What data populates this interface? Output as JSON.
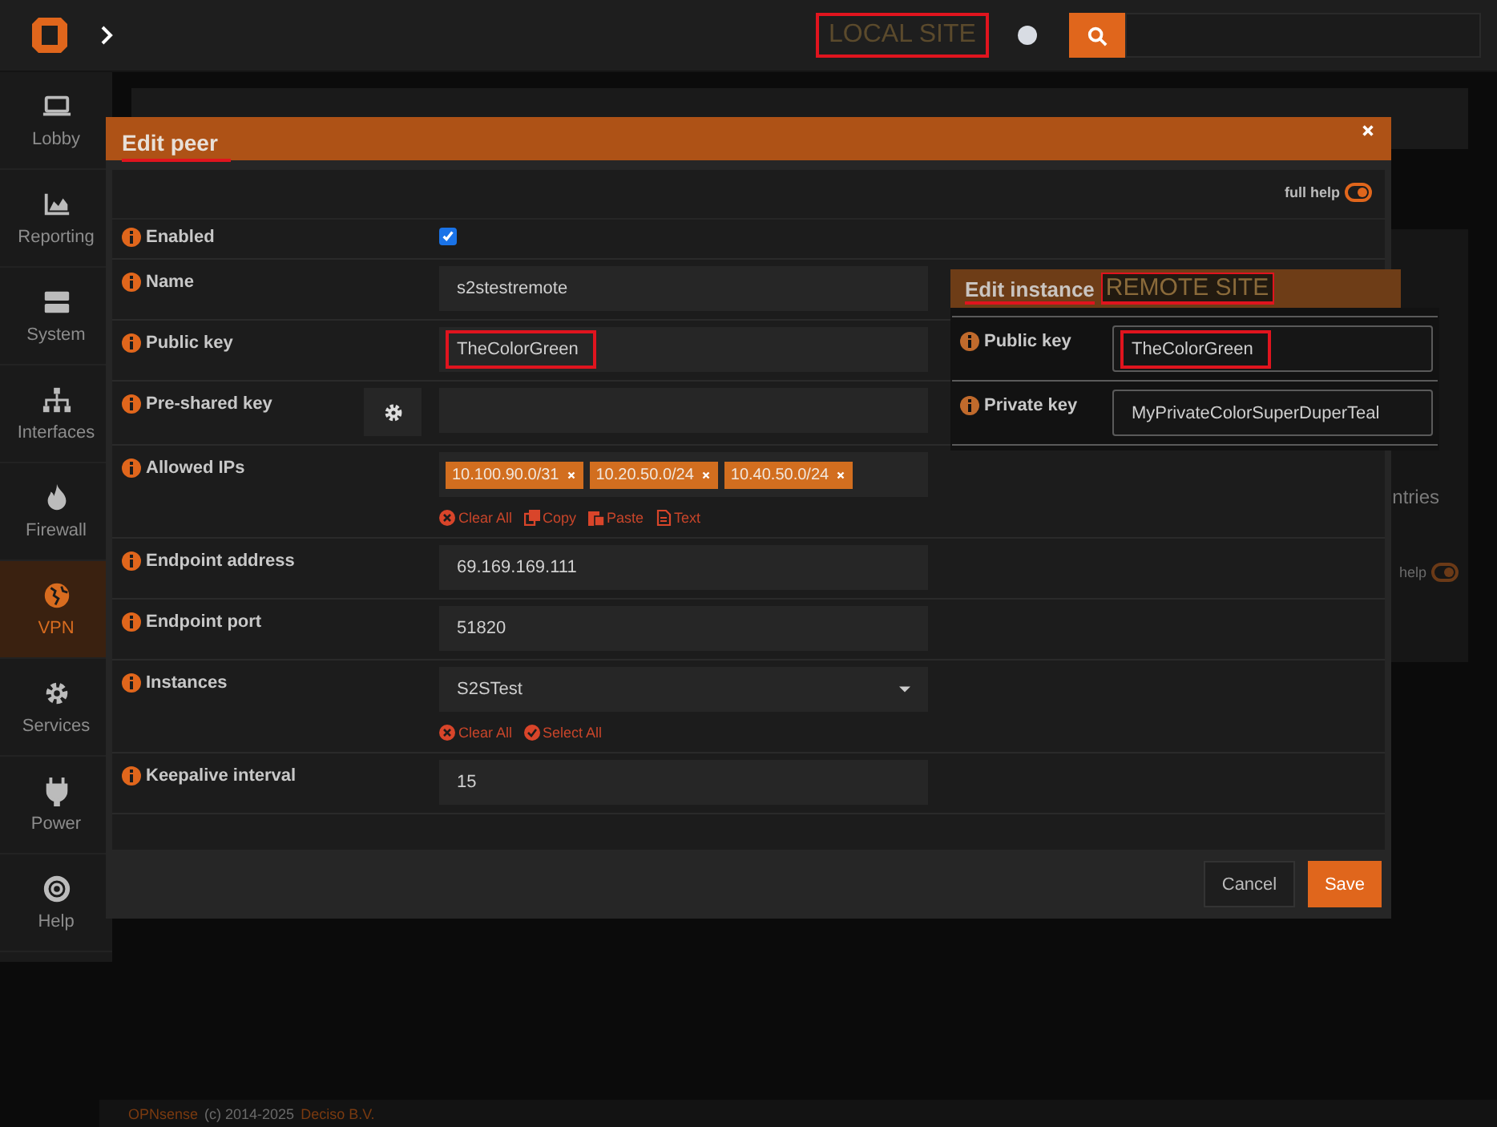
{
  "topbar": {
    "site_label": "LOCAL SITE"
  },
  "sidebar": {
    "items": [
      {
        "label": "Lobby",
        "selected": false
      },
      {
        "label": "Reporting",
        "selected": false
      },
      {
        "label": "System",
        "selected": false
      },
      {
        "label": "Interfaces",
        "selected": false
      },
      {
        "label": "Firewall",
        "selected": false
      },
      {
        "label": "VPN",
        "selected": true
      },
      {
        "label": "Services",
        "selected": false
      },
      {
        "label": "Power",
        "selected": false
      },
      {
        "label": "Help",
        "selected": false
      }
    ]
  },
  "page": {
    "entries_fragment": "ntries",
    "help_fragment": "help",
    "help_on": true
  },
  "modal": {
    "title": "Edit peer",
    "full_help": {
      "label": "full help",
      "on": true
    },
    "fields": [
      {
        "kind": "checkbox",
        "label": "Enabled",
        "checked": true
      },
      {
        "kind": "text",
        "label": "Name",
        "value": "s2stestremote"
      },
      {
        "kind": "text",
        "label": "Public key",
        "value": "TheColorGreen",
        "highlighted": true
      },
      {
        "kind": "generate",
        "label": "Pre-shared key"
      },
      {
        "kind": "tokens",
        "label": "Allowed IPs",
        "tokens": [
          "10.100.90.0/31",
          "10.20.50.0/24",
          "10.40.50.0/24"
        ],
        "actions": [
          {
            "kind": "clear",
            "label": "Clear All"
          },
          {
            "kind": "copy",
            "label": "Copy"
          },
          {
            "kind": "paste",
            "label": "Paste"
          },
          {
            "kind": "text",
            "label": "Text"
          }
        ]
      },
      {
        "kind": "text",
        "label": "Endpoint address",
        "value": "69.169.169.111"
      },
      {
        "kind": "text",
        "label": "Endpoint port",
        "value": "51820"
      },
      {
        "kind": "select",
        "label": "Instances",
        "value": "S2STest",
        "actions": [
          {
            "kind": "clear",
            "label": "Clear All"
          },
          {
            "kind": "select",
            "label": "Select All"
          }
        ]
      },
      {
        "kind": "text",
        "label": "Keepalive interval",
        "value": "15"
      }
    ],
    "buttons": [
      {
        "kind": "default",
        "label": "Cancel"
      },
      {
        "kind": "primary",
        "label": "Save"
      }
    ]
  },
  "instance_panel": {
    "title": "Edit instance",
    "site_label": "REMOTE SITE",
    "fields": [
      {
        "label": "Public key",
        "value": "TheColorGreen",
        "highlighted": true
      },
      {
        "label": "Private key",
        "value": "MyPrivateColorSuperDuperTeal",
        "highlighted": false
      }
    ]
  },
  "footer": {
    "brand": "OPNsense",
    "text": "(c) 2014-2025",
    "company": "Deciso B.V."
  }
}
